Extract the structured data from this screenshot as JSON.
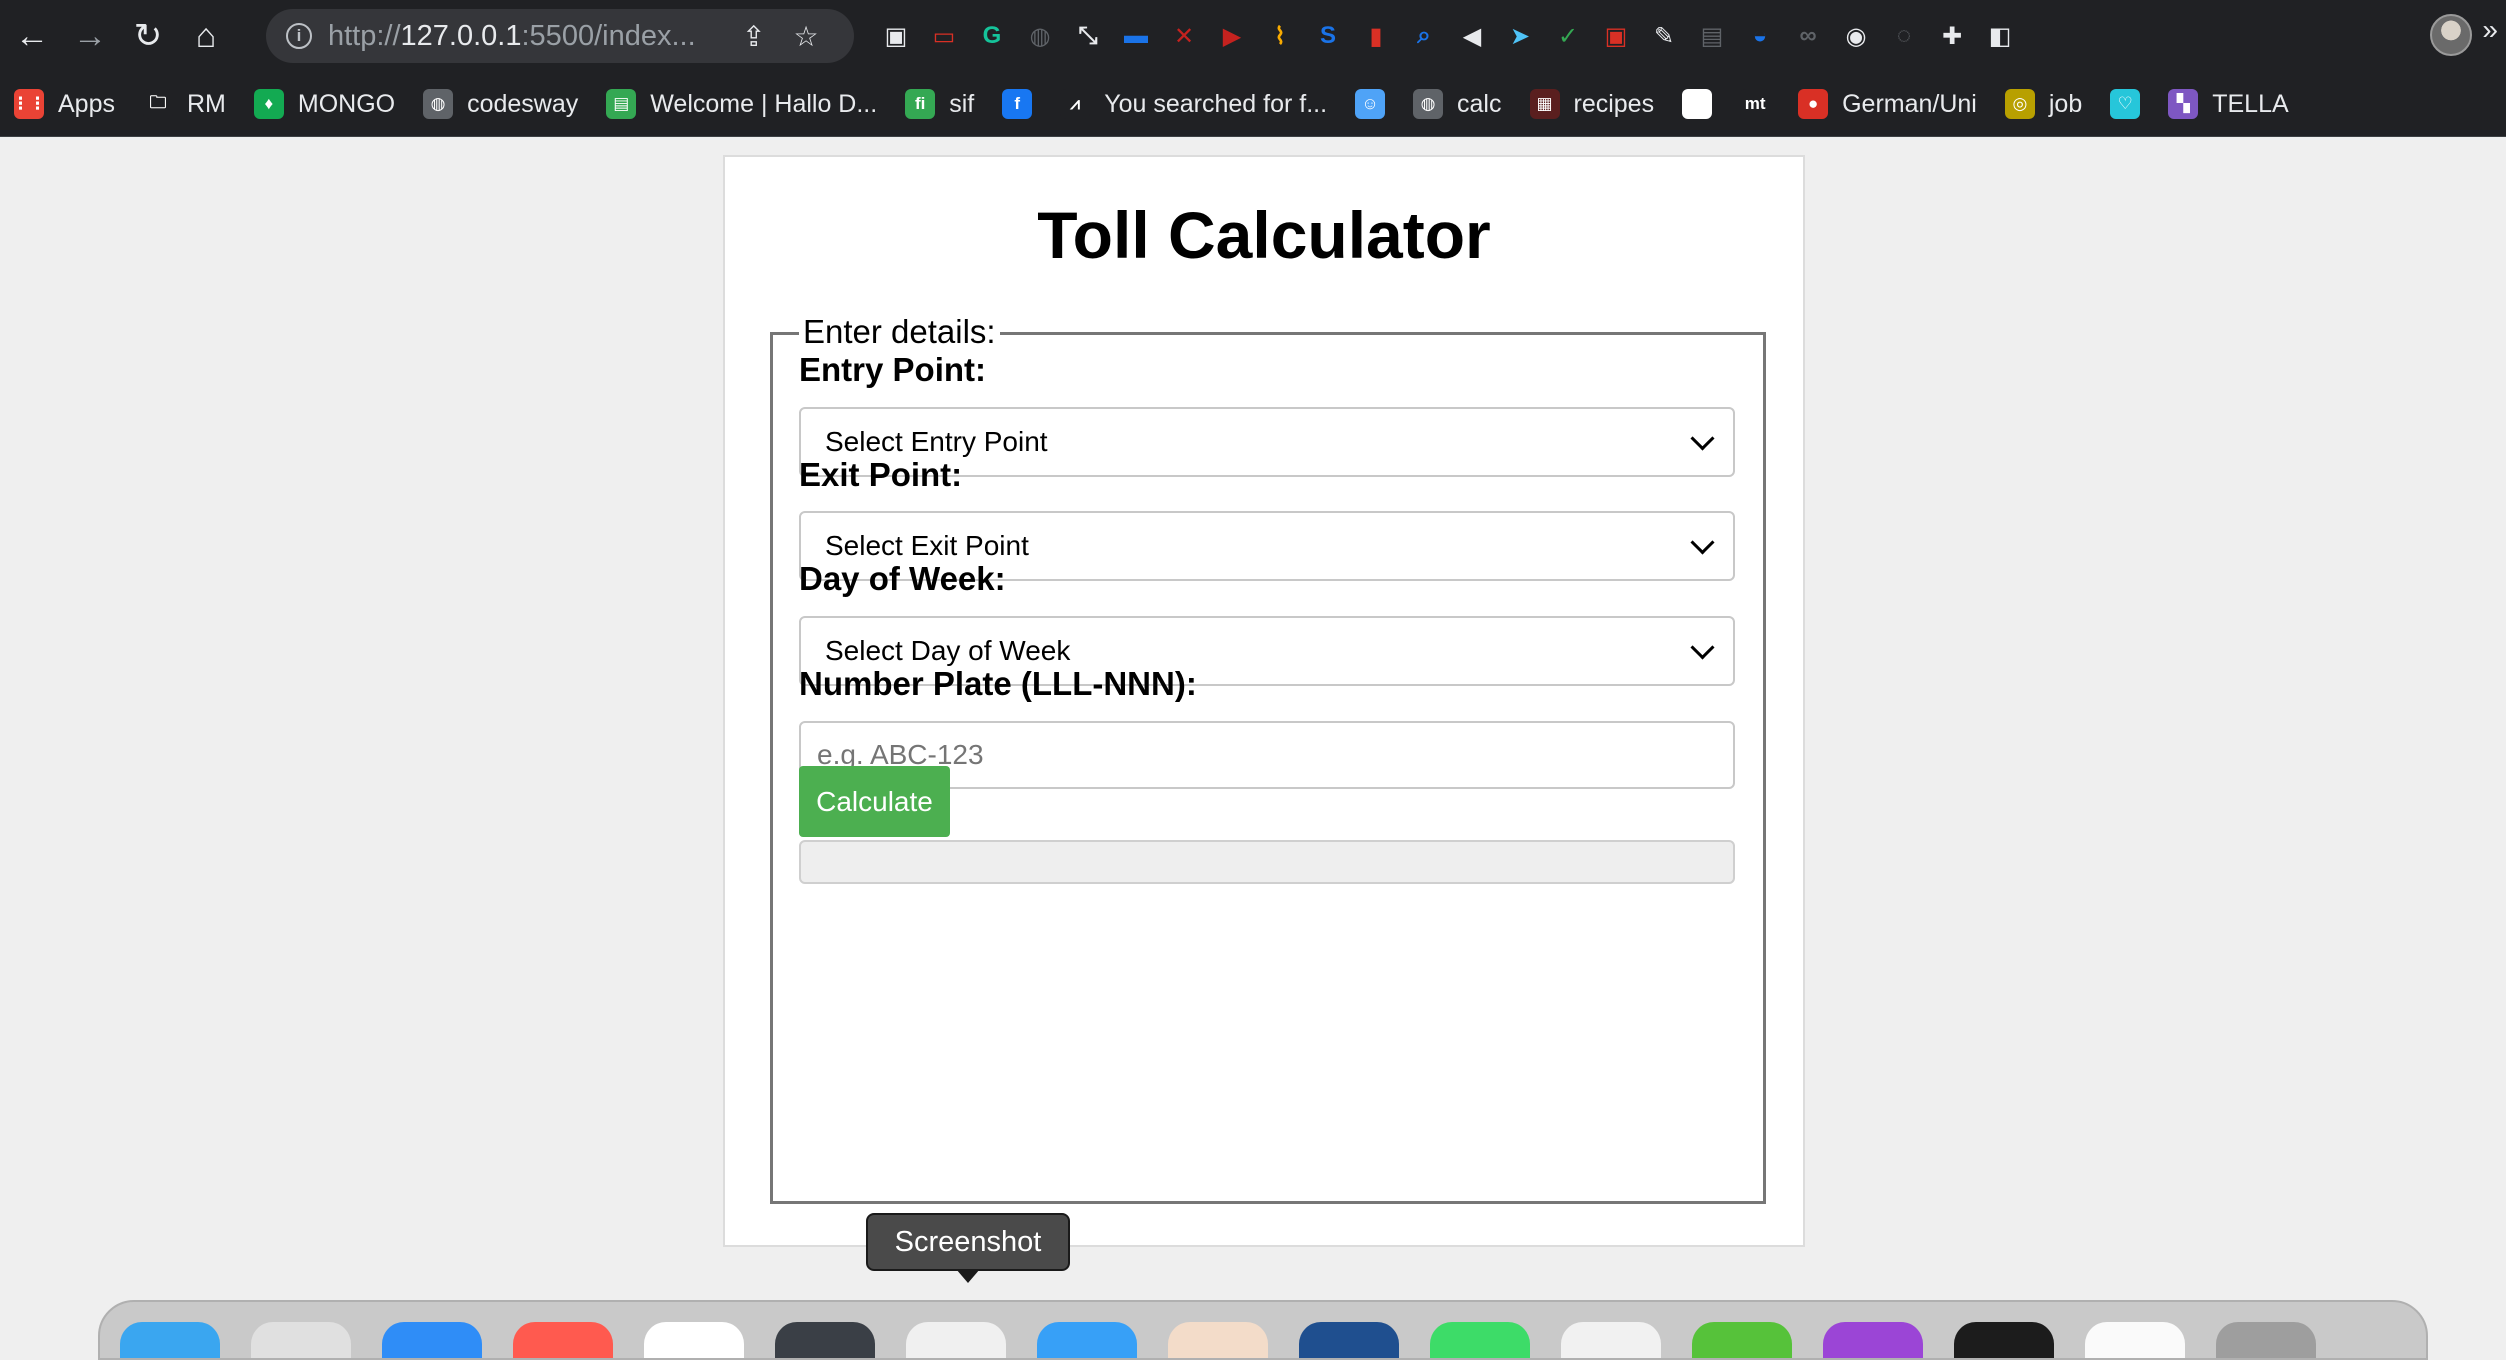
{
  "browser": {
    "url_prefix": "http://",
    "url_host": "127.0.0.1",
    "url_rest": ":5500/index...",
    "extensions": [
      {
        "name": "tab-view-icon",
        "color": "#e8eaed",
        "glyph": "▣"
      },
      {
        "name": "ext-red-icon",
        "color": "#d93025",
        "glyph": "▭"
      },
      {
        "name": "grammarly-icon",
        "color": "#15c39a",
        "glyph": "G"
      },
      {
        "name": "mouse-icon",
        "color": "#5f6368",
        "glyph": "◍"
      },
      {
        "name": "resize-icon",
        "color": "#e8eaed",
        "glyph": "⤡"
      },
      {
        "name": "ext-blue-icon",
        "color": "#1a73e8",
        "glyph": "▬"
      },
      {
        "name": "ext-red-circle-icon",
        "color": "#c5221f",
        "glyph": "✕"
      },
      {
        "name": "youtube-icon",
        "color": "#c5221f",
        "glyph": "▶"
      },
      {
        "name": "broom-icon",
        "color": "#f9ab00",
        "glyph": "⌇"
      },
      {
        "name": "ext-st-icon",
        "color": "#1a73e8",
        "glyph": "S"
      },
      {
        "name": "bookmark-red-icon",
        "color": "#d93025",
        "glyph": "▮"
      },
      {
        "name": "search-ext-icon",
        "color": "#1a73e8",
        "glyph": "⌕"
      },
      {
        "name": "volume-icon",
        "color": "#e8eaed",
        "glyph": "◀"
      },
      {
        "name": "ext-arrow-icon",
        "color": "#4fc3f7",
        "glyph": "➤"
      },
      {
        "name": "shield-icon",
        "color": "#34a853",
        "glyph": "✓"
      },
      {
        "name": "ext-cast-icon",
        "color": "#d93025",
        "glyph": "▣"
      },
      {
        "name": "feather-icon",
        "color": "#e8eaed",
        "glyph": "✎"
      },
      {
        "name": "reader-icon",
        "color": "#5f6368",
        "glyph": "▤"
      },
      {
        "name": "mask-icon",
        "color": "#1a73e8",
        "glyph": "◒"
      },
      {
        "name": "glasses-icon",
        "color": "#5f6368",
        "glyph": "∞"
      },
      {
        "name": "robot-icon",
        "color": "#e8eaed",
        "glyph": "◉"
      },
      {
        "name": "chat-icon",
        "color": "#5f6368",
        "glyph": "◌"
      },
      {
        "name": "puzzle-icon",
        "color": "#e8eaed",
        "glyph": "✚"
      },
      {
        "name": "sidepanel-icon",
        "color": "#e8eaed",
        "glyph": "◧"
      }
    ]
  },
  "bookmarks": [
    {
      "name": "bookmark-apps",
      "label": "Apps",
      "icon": "apps-grid-icon",
      "color": "#ea4335",
      "glyph": "⋮⋮"
    },
    {
      "name": "bookmark-rm",
      "label": "RM",
      "icon": "folder-icon",
      "color": "#202124",
      "glyph": "🗀"
    },
    {
      "name": "bookmark-mongo",
      "label": "MONGO",
      "icon": "mongodb-leaf-icon",
      "color": "#13aa52",
      "glyph": "♦"
    },
    {
      "name": "bookmark-codesway",
      "label": "codesway",
      "icon": "globe-icon",
      "color": "#5f6368",
      "glyph": "◍"
    },
    {
      "name": "bookmark-welcome",
      "label": "Welcome | Hallo D...",
      "icon": "doc-icon",
      "color": "#34a853",
      "glyph": "▤"
    },
    {
      "name": "bookmark-sif",
      "label": "sif",
      "icon": "sif-icon",
      "color": "#34a853",
      "glyph": "fi"
    },
    {
      "name": "bookmark-facebook",
      "label": "",
      "icon": "facebook-icon",
      "color": "#1877f2",
      "glyph": "f"
    },
    {
      "name": "bookmark-search",
      "label": "You searched for f...",
      "icon": "search-site-icon",
      "color": "#202124",
      "glyph": "⩘"
    },
    {
      "name": "bookmark-finder",
      "label": "",
      "icon": "finder-icon",
      "color": "#4fa3f7",
      "glyph": "☺"
    },
    {
      "name": "bookmark-calc",
      "label": "calc",
      "icon": "globe-icon",
      "color": "#5f6368",
      "glyph": "◍"
    },
    {
      "name": "bookmark-recipes",
      "label": "recipes",
      "icon": "recipes-icon",
      "color": "#5a1f1f",
      "glyph": "▦"
    },
    {
      "name": "bookmark-star",
      "label": "",
      "icon": "star-box-icon",
      "color": "#ffffff",
      "glyph": "★"
    },
    {
      "name": "bookmark-mt",
      "label": "",
      "icon": "mt-icon",
      "color": "#202124",
      "glyph": "mt"
    },
    {
      "name": "bookmark-german",
      "label": "German/Uni",
      "icon": "flag-icon",
      "color": "#d93025",
      "glyph": "●"
    },
    {
      "name": "bookmark-job",
      "label": "job",
      "icon": "target-icon",
      "color": "#b8a000",
      "glyph": "◎"
    },
    {
      "name": "bookmark-heart",
      "label": "",
      "icon": "heart-box-icon",
      "color": "#26c6da",
      "glyph": "♡"
    },
    {
      "name": "bookmark-tella",
      "label": "TELLA",
      "icon": "tella-icon",
      "color": "#7e57c2",
      "glyph": "▚"
    }
  ],
  "page": {
    "title": "Toll Calculator",
    "legend": "Enter details:",
    "entry_label": "Entry Point:",
    "entry_value": "Select Entry Point",
    "exit_label": "Exit Point:",
    "exit_value": "Select Exit Point",
    "day_label": "Day of Week:",
    "day_value": "Select Day of Week",
    "plate_label": "Number Plate (LLL-NNN):",
    "plate_placeholder": "e.g. ABC-123",
    "calculate_label": "Calculate",
    "result_text": ""
  },
  "tooltip": {
    "text": "Screenshot"
  },
  "dock": {
    "apps": [
      {
        "name": "dock-finder",
        "color": "#3aa6f0"
      },
      {
        "name": "dock-launchpad",
        "color": "#e0e0e0"
      },
      {
        "name": "dock-safari",
        "color": "#2f8df7"
      },
      {
        "name": "dock-calendar",
        "color": "#ff5a4f"
      },
      {
        "name": "dock-notes",
        "color": "#ffffff"
      },
      {
        "name": "dock-app-dark",
        "color": "#3a3f46"
      },
      {
        "name": "dock-preview",
        "color": "#f0f0f0"
      },
      {
        "name": "dock-appstore",
        "color": "#37a0f7"
      },
      {
        "name": "dock-app-beige",
        "color": "#f3dcc9"
      },
      {
        "name": "dock-word",
        "color": "#1f4f8f"
      },
      {
        "name": "dock-messages",
        "color": "#3ddc68"
      },
      {
        "name": "dock-chrome",
        "color": "#f1f1f1"
      },
      {
        "name": "dock-app-green",
        "color": "#56c23a"
      },
      {
        "name": "dock-podcasts",
        "color": "#9b45d6"
      },
      {
        "name": "dock-terminal",
        "color": "#1c1c1c"
      },
      {
        "name": "dock-app-white",
        "color": "#fafafa"
      },
      {
        "name": "dock-trash",
        "color": "#9e9e9e"
      }
    ]
  }
}
